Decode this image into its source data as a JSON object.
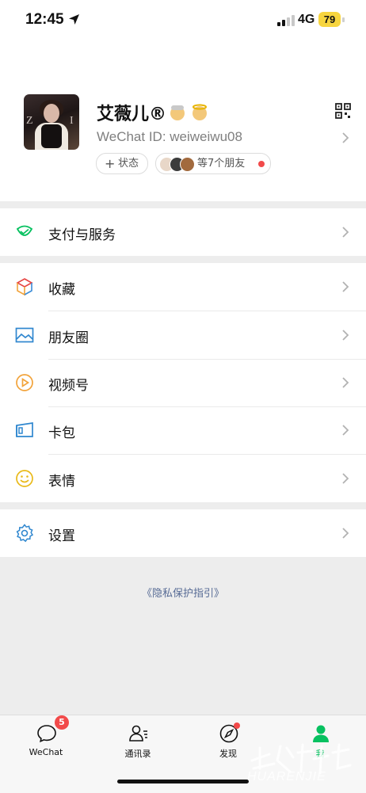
{
  "status_bar": {
    "time": "12:45",
    "network": "4G",
    "battery": "79"
  },
  "profile": {
    "nickname": "艾薇儿®",
    "wechat_id": "WeChat ID: weiweiwu08",
    "status_button": "状态",
    "friends_text": "等7个朋友"
  },
  "menu": {
    "pay": "支付与服务",
    "favorites": "收藏",
    "moments": "朋友圈",
    "channels": "视频号",
    "cards": "卡包",
    "stickers": "表情",
    "settings": "设置"
  },
  "privacy_link": "《隐私保护指引》",
  "tabs": [
    {
      "label": "WeChat",
      "badge": "5"
    },
    {
      "label": "通讯录"
    },
    {
      "label": "发现"
    },
    {
      "label": "我"
    }
  ],
  "watermark": "HUARENJIE",
  "colors": {
    "accent": "#07c160",
    "badge_red": "#f24a4a",
    "link": "#576b95",
    "battery": "#f7d53f"
  }
}
